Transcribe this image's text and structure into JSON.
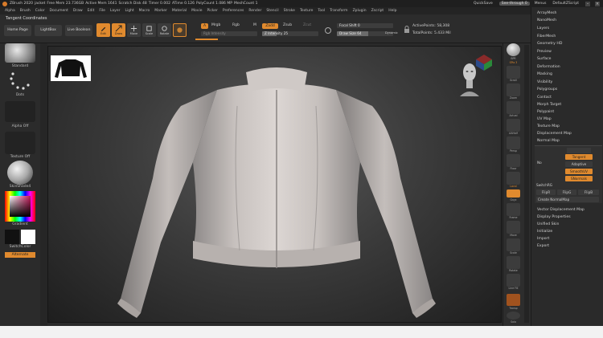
{
  "titlebar": {
    "items": [
      "ZBrush 2020",
      "jacket",
      "Free Mem 23.736GB",
      "Active Mem 1641",
      "Scratch Disk 48",
      "Timer 0.002",
      "ATime 0.126",
      "PolyCount 1.086 MP",
      "MeshCount 1"
    ],
    "quicksave": "QuickSave",
    "see_through": "See-through 0",
    "menus_label": "Menus",
    "script_label": "DefaultZScript"
  },
  "menubar": {
    "items": [
      "Alpha",
      "Brush",
      "Color",
      "Document",
      "Draw",
      "Edit",
      "File",
      "Layer",
      "Light",
      "Macro",
      "Marker",
      "Material",
      "Movie",
      "Picker",
      "Preferences",
      "Render",
      "Stencil",
      "Stroke",
      "Texture",
      "Tool",
      "Transform",
      "Zplugin",
      "Zscript",
      "Help"
    ]
  },
  "shelf": {
    "subtitle": "Tangent Coordinates",
    "home_page": "Home Page",
    "lightbox": "LightBox",
    "live_boolean": "Live Boolean",
    "edit": "Edit",
    "draw": "Draw",
    "move": "Move",
    "scale": "Scale",
    "rotate": "Rotate",
    "a_label": "A",
    "mrgb": "Mrgb",
    "rgb": "Rgb",
    "m": "M",
    "zadd": "Zadd",
    "zsub": "Zsub",
    "zcut": "Zcut",
    "rgb_intensity": "Rgb Intensity",
    "z_intensity": "Z Intensity 25",
    "z_intensity_level": 0.25,
    "focal_shift": "Focal Shift 0",
    "draw_size": "Draw Size 64",
    "draw_size_level": 0.55,
    "dynamic": "Dynamic",
    "active_points": "ActivePoints: 58,308",
    "total_points": "TotalPoints: 5.433 Mil"
  },
  "left_panel": {
    "standard": "Standard",
    "dots": "Dots",
    "alpha_off": "Alpha Off",
    "texture_off": "Texture Off",
    "material": "SkinShade4",
    "gradient": "Gradient",
    "switch_color": "SwitchColor",
    "alternate": "Alternate"
  },
  "right_shelf": {
    "buttons": [
      "BPR",
      "SPix 3",
      "Scroll",
      "Zoom",
      "Actual",
      "AAHalf",
      "Persp",
      "Floor",
      "Local",
      "Gxyz",
      "Frame",
      "Move",
      "Scale",
      "Rotate",
      "Line Fill",
      "Transp",
      "Ghost",
      "Solo",
      "Xpose"
    ]
  },
  "tray": {
    "items_top": [
      "ArrayMesh",
      "NanoMesh",
      "Layers",
      "FiberMesh",
      "Geometry HD",
      "Preview",
      "Surface",
      "Deformation",
      "Masking",
      "Visibility",
      "Polygroups",
      "Contact",
      "Morph Target",
      "Polypaint",
      "UV Map",
      "Texture Map",
      "Displacement Map",
      "Normal Map"
    ],
    "normal_map": {
      "no": "No",
      "tangent": "Tangent",
      "adaptive": "Adaptive",
      "smooth_uv": "SmoothUV",
      "use_map": "SNormals",
      "switch_rg": "SwitchRG",
      "flip_r": "FlipR",
      "flip_g": "FlipG",
      "flip_b": "FlipB",
      "create": "Create NormalMap"
    },
    "items_bottom": [
      "Vector Displacement Map",
      "Display Properties",
      "Unified Skin",
      "Initialize",
      "Import",
      "Export"
    ]
  },
  "colors": {
    "accent": "#e08a2e",
    "background": "#2a2a2a",
    "viewport_center": "#5a5a5a",
    "status_bar": "#f2f2f2"
  }
}
